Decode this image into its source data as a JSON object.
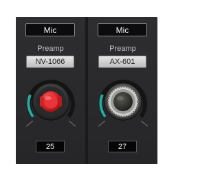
{
  "channels": [
    {
      "source_label": "Mic",
      "preamp_label": "Preamp",
      "preamp_model": "NV-1066",
      "gain_value": "25",
      "knob_color": "#e8252b"
    },
    {
      "source_label": "Mic",
      "preamp_label": "Preamp",
      "preamp_model": "AX-601",
      "gain_value": "27",
      "knob_color": "#3a3a36"
    }
  ],
  "colors": {
    "panel_bg": "#2a2a2c",
    "arc_accent": "#25a9a0"
  },
  "icons": [
    "gain-knob-icon"
  ]
}
